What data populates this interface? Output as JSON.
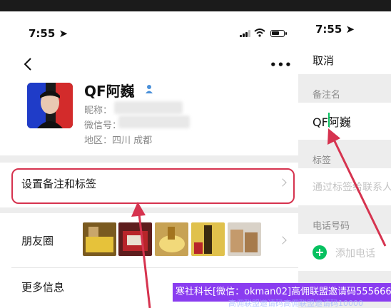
{
  "left_screen": {
    "status_bar": {
      "time": "7:55 ➤",
      "more_label": "•••"
    },
    "profile": {
      "name": "QF阿巍",
      "nickname_label": "昵称：",
      "wechat_id_label": "微信号：",
      "region": "地区：四川 成都"
    },
    "rows": {
      "remark_tags": "设置备注和标签",
      "moments": "朋友圈",
      "more_info": "更多信息"
    }
  },
  "right_screen": {
    "status_bar": {
      "time": "7:55 ➤"
    },
    "cancel": "取消",
    "remark_section_label": "备注名",
    "remark_value": "QF阿巍",
    "tags_section_label": "标签",
    "tags_placeholder": "通过标签给联系人",
    "phone_section_label": "电话号码",
    "add_phone_label": "添加电话"
  },
  "watermark": {
    "text": "寒社科长[微信：okman02]高佣联盟邀请码555666",
    "subtext": "高佣联盟邀请码高佣联盟邀请码10000"
  },
  "colors": {
    "accent": "#d6334f",
    "wechat_green": "#07c160",
    "watermark_bg": "#8a3df0"
  }
}
